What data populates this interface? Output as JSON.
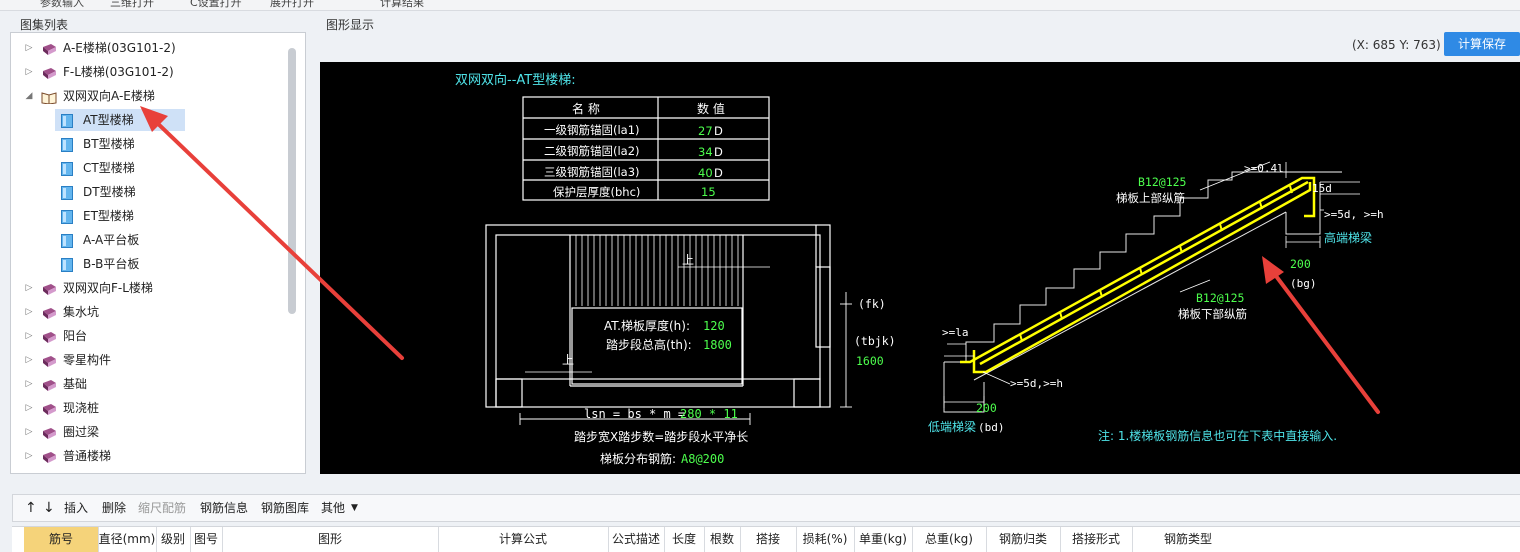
{
  "top_toolbar": {
    "items": [
      "参数输入",
      "三维打开",
      "C设置打开",
      "展开打开",
      "计算结果"
    ]
  },
  "left_panel": {
    "title": "图集列表",
    "tree": [
      {
        "label": "A-E楼梯(03G101-2)",
        "type": "book",
        "expanded": false
      },
      {
        "label": "F-L楼梯(03G101-2)",
        "type": "book",
        "expanded": false
      },
      {
        "label": "双网双向A-E楼梯",
        "type": "open-book",
        "expanded": true
      },
      {
        "label": "AT型楼梯",
        "type": "doc",
        "selected": true
      },
      {
        "label": "BT型楼梯",
        "type": "doc"
      },
      {
        "label": "CT型楼梯",
        "type": "doc"
      },
      {
        "label": "DT型楼梯",
        "type": "doc"
      },
      {
        "label": "ET型楼梯",
        "type": "doc"
      },
      {
        "label": "A-A平台板",
        "type": "doc"
      },
      {
        "label": "B-B平台板",
        "type": "doc"
      },
      {
        "label": "双网双向F-L楼梯",
        "type": "book",
        "expanded": false
      },
      {
        "label": "集水坑",
        "type": "book",
        "expanded": false
      },
      {
        "label": "阳台",
        "type": "book",
        "expanded": false
      },
      {
        "label": "零星构件",
        "type": "book",
        "expanded": false
      },
      {
        "label": "基础",
        "type": "book",
        "expanded": false
      },
      {
        "label": "现浇桩",
        "type": "book",
        "expanded": false
      },
      {
        "label": "圈过梁",
        "type": "book",
        "expanded": false
      },
      {
        "label": "普通楼梯",
        "type": "book",
        "expanded": false
      }
    ]
  },
  "right_panel": {
    "title": "图形显示",
    "coords": "(X: 685 Y: 763)",
    "save_button": "计算保存"
  },
  "drawing": {
    "title": "双网双向--AT型楼梯:",
    "table_headers": [
      "名  称",
      "数  值"
    ],
    "table_rows": [
      {
        "name": "一级钢筋锚固(la1)",
        "value": "27",
        "unit": "D"
      },
      {
        "name": "二级钢筋锚固(la2)",
        "value": "34",
        "unit": "D"
      },
      {
        "name": "三级钢筋锚固(la3)",
        "value": "40",
        "unit": "D"
      },
      {
        "name": "保护层厚度(bhc)",
        "value": "15",
        "unit": ""
      }
    ],
    "plan_up_label_top": "上",
    "plan_up_label_bottom": "上",
    "thickness_label": "AT.梯板厚度(h):",
    "thickness_value": "120",
    "height_label": "踏步段总高(th):",
    "height_value": "1800",
    "fk_label": "(fk)",
    "tbjk_label": "(tbjk)",
    "tbjk_value": "1600",
    "lsn_label": "lsn = bs * m =",
    "lsn_value": "280 * 11",
    "lsn_caption": "踏步宽X踏步数=踏步段水平净长",
    "dist_label": "梯板分布钢筋:",
    "dist_value": "A8@200",
    "upper_rebar_spec": "B12@125",
    "upper_rebar_label": "梯板上部纵筋",
    "lower_rebar_spec": "B12@125",
    "lower_rebar_label": "梯板下部纵筋",
    "dim_04l": ">=0.4l",
    "dim_15d": "15d",
    "dim_5d_right": ">=5d, >=h",
    "high_beam": "高端梯梁",
    "dim_200_right": "200",
    "bg_label": "(bg)",
    "dim_la": ">=la",
    "dim_5d_left": ">=5d,>=h",
    "dim_200_left": "200",
    "low_beam": "低端梯梁",
    "bd_label": "(bd)",
    "note": "注: 1.楼梯板钢筋信息也可在下表中直接输入."
  },
  "bottom_toolbar": {
    "up_arrow": "↑",
    "down_arrow": "↓",
    "buttons": [
      "插入",
      "删除",
      "缩尺配筋",
      "钢筋信息",
      "钢筋图库",
      "其他"
    ]
  },
  "grid_headers": [
    "筋号",
    "直径(mm)",
    "级别",
    "图号",
    "图形",
    "计算公式",
    "公式描述",
    "长度",
    "根数",
    "搭接",
    "损耗(%)",
    "单重(kg)",
    "总重(kg)",
    "钢筋归类",
    "搭接形式",
    "钢筋类型"
  ],
  "colors": {
    "accent": "#2f8ae5",
    "drawing_cyan": "#4fe3e8",
    "drawing_green": "#4dff4d",
    "drawing_yellow": "#ffff00",
    "arrow_red": "#e8403a",
    "selected_row": "#cfe1f7"
  }
}
